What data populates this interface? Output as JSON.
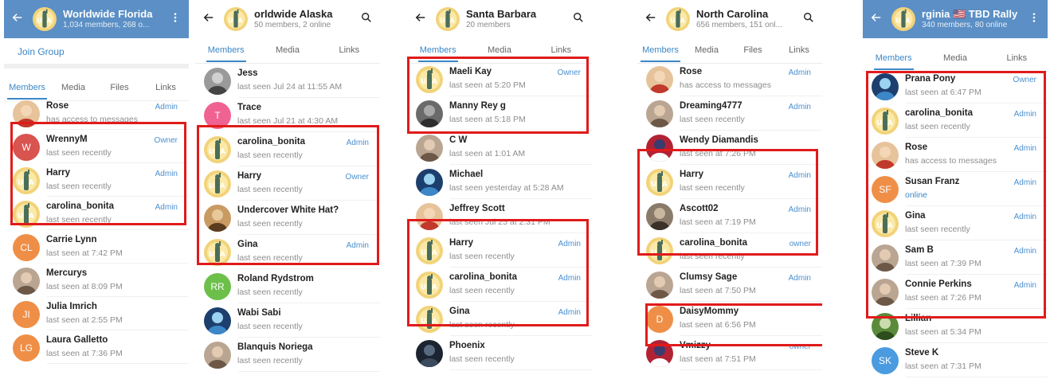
{
  "colors": {
    "header_blue": "#5b8fc5",
    "accent": "#3b87c7",
    "highlight": "#e01b1b"
  },
  "panels": [
    {
      "header": {
        "style": "blue",
        "back_icon": "arrow-left-icon",
        "title": "Worldwide Florida",
        "subtitle": "1,034 members, 268 o...",
        "actions": [
          "more-vert-icon"
        ]
      },
      "join_label": "Join Group",
      "tabs": [
        "Members",
        "Media",
        "Files",
        "Links"
      ],
      "members": [
        {
          "name": "Rose",
          "status": "has access to messages",
          "role": "Admin",
          "avatar": "photo-red-hair"
        },
        {
          "name": "WrennyM",
          "status": "last seen recently",
          "role": "Owner",
          "avatar": "letter",
          "initials": "W",
          "color": "#d9534f"
        },
        {
          "name": "Harry",
          "status": "last seen recently",
          "role": "Admin",
          "avatar": "liberty"
        },
        {
          "name": "carolina_bonita",
          "status": "last seen recently",
          "role": "Admin",
          "avatar": "liberty"
        },
        {
          "name": "Carrie Lynn",
          "status": "last seen at 7:42 PM",
          "role": "",
          "avatar": "letter",
          "initials": "CL",
          "color": "#ef8f47"
        },
        {
          "name": "Mercurys",
          "status": "last seen at 8:09 PM",
          "role": "",
          "avatar": "photo-portrait"
        },
        {
          "name": "Julia Imrich",
          "status": "last seen at 2:55 PM",
          "role": "",
          "avatar": "letter",
          "initials": "JI",
          "color": "#ef8f47"
        },
        {
          "name": "Laura Galletto",
          "status": "last seen at 7:36 PM",
          "role": "",
          "avatar": "letter",
          "initials": "LG",
          "color": "#ef8f47"
        }
      ]
    },
    {
      "header": {
        "style": "white",
        "back_icon": "arrow-left-icon",
        "title": "orldwide Alaska",
        "subtitle": "50 members, 2 online",
        "actions": [
          "search-icon"
        ]
      },
      "tabs": [
        "Members",
        "Media",
        "Links"
      ],
      "members": [
        {
          "name": "Jess",
          "status": "last seen Jul 24 at 11:55 AM",
          "role": "",
          "avatar": "photo-bw"
        },
        {
          "name": "Trace",
          "status": "last seen Jul 21 at 4:30 AM",
          "role": "",
          "avatar": "letter",
          "initials": "T",
          "color": "#f06292"
        },
        {
          "name": "carolina_bonita",
          "status": "last seen recently",
          "role": "Admin",
          "avatar": "liberty"
        },
        {
          "name": "Harry",
          "status": "last seen recently",
          "role": "Owner",
          "avatar": "liberty"
        },
        {
          "name": "Undercover White Hat? Kyle",
          "status": "last seen recently",
          "role": "",
          "avatar": "photo-book"
        },
        {
          "name": "Gina",
          "status": "last seen recently",
          "role": "Admin",
          "avatar": "liberty"
        },
        {
          "name": "Roland Rydstrom",
          "status": "last seen recently",
          "role": "",
          "avatar": "letter",
          "initials": "RR",
          "color": "#6cc04a"
        },
        {
          "name": "Wabi Sabi",
          "status": "last seen recently",
          "role": "",
          "avatar": "photo-earth"
        },
        {
          "name": "Blanquis Noriega",
          "status": "last seen recently",
          "role": "",
          "avatar": "photo-portrait"
        }
      ]
    },
    {
      "header": {
        "style": "white",
        "back_icon": "arrow-left-icon",
        "title": "Santa Barbara",
        "subtitle": "20 members",
        "actions": [
          "search-icon"
        ]
      },
      "tabs": [
        "Members",
        "Media",
        "Links"
      ],
      "members": [
        {
          "name": "Maeli Kay",
          "status": "last seen at 5:20 PM",
          "role": "Owner",
          "avatar": "liberty"
        },
        {
          "name": "Manny Rey g",
          "status": "last seen at 5:18 PM",
          "role": "",
          "avatar": "photo-dog"
        },
        {
          "name": "C W",
          "status": "last seen at 1:01 AM",
          "role": "",
          "avatar": "photo-portrait"
        },
        {
          "name": "Michael",
          "status": "last seen yesterday at 5:28 AM",
          "role": "",
          "avatar": "photo-earth"
        },
        {
          "name": "Jeffrey Scott",
          "status": "last seen Jul 25 at 2:31 PM",
          "role": "",
          "avatar": "photo-red-hair"
        },
        {
          "name": "Harry",
          "status": "last seen recently",
          "role": "Admin",
          "avatar": "liberty"
        },
        {
          "name": "carolina_bonita",
          "status": "last seen recently",
          "role": "Admin",
          "avatar": "liberty"
        },
        {
          "name": "Gina",
          "status": "last seen recently",
          "role": "Admin",
          "avatar": "liberty"
        },
        {
          "name": "Phoenix",
          "status": "last seen recently",
          "role": "",
          "avatar": "photo-dark"
        }
      ]
    },
    {
      "header": {
        "style": "white",
        "back_icon": "arrow-left-icon",
        "title": "North Carolina",
        "subtitle": "656 members, 151 onl...",
        "actions": [
          "search-icon"
        ]
      },
      "tabs": [
        "Members",
        "Media",
        "Files",
        "Links"
      ],
      "members": [
        {
          "name": "Rose",
          "status": "has access to messages",
          "role": "Admin",
          "avatar": "photo-red-hair"
        },
        {
          "name": "Dreaming4777",
          "status": "last seen recently",
          "role": "Admin",
          "avatar": "photo-portrait"
        },
        {
          "name": "Wendy Diamandis",
          "status": "last seen at 7:26 PM",
          "role": "",
          "avatar": "photo-flag"
        },
        {
          "name": "Harry",
          "status": "last seen recently",
          "role": "Admin",
          "avatar": "liberty"
        },
        {
          "name": "Ascott02",
          "status": "last seen at 7:19 PM",
          "role": "Admin",
          "avatar": "photo-cat"
        },
        {
          "name": "carolina_bonita",
          "status": "last seen recently",
          "role": "owner",
          "avatar": "liberty"
        },
        {
          "name": "Clumsy Sage",
          "status": "last seen at 7:50 PM",
          "role": "Admin",
          "avatar": "photo-portrait"
        },
        {
          "name": "DaisyMommy",
          "status": "last seen at 6:56 PM",
          "role": "",
          "avatar": "letter",
          "initials": "D",
          "color": "#ef8f47"
        },
        {
          "name": "Vmizzy",
          "status": "last seen at 7:51 PM",
          "role": "owner",
          "avatar": "photo-flag"
        }
      ]
    },
    {
      "header": {
        "style": "blue",
        "back_icon": "arrow-left-icon",
        "title": "rginia 🇺🇸 TBD Rally",
        "subtitle": "340 members, 80 online",
        "actions": [
          "more-vert-icon"
        ]
      },
      "tabs": [
        "Members",
        "Media",
        "Links"
      ],
      "members": [
        {
          "name": "Prana Pony",
          "status": "last seen at 6:47 PM",
          "role": "Owner",
          "avatar": "photo-earth"
        },
        {
          "name": "carolina_bonita",
          "status": "last seen recently",
          "role": "Admin",
          "avatar": "liberty"
        },
        {
          "name": "Rose",
          "status": "has access to messages",
          "role": "Admin",
          "avatar": "photo-red-hair"
        },
        {
          "name": "Susan Franz",
          "status": "online",
          "role": "Admin",
          "avatar": "letter",
          "initials": "SF",
          "color": "#ef8f47"
        },
        {
          "name": "Gina",
          "status": "last seen recently",
          "role": "Admin",
          "avatar": "liberty"
        },
        {
          "name": "Sam B",
          "status": "last seen at 7:39 PM",
          "role": "Admin",
          "avatar": "photo-portrait"
        },
        {
          "name": "Connie Perkins",
          "status": "last seen at 7:26 PM",
          "role": "Admin",
          "avatar": "photo-portrait"
        },
        {
          "name": "Lillian",
          "status": "last seen at 5:34 PM",
          "role": "",
          "avatar": "photo-tree"
        },
        {
          "name": "Steve K",
          "status": "last seen at 7:31 PM",
          "role": "",
          "avatar": "letter",
          "initials": "SK",
          "color": "#4a9be0"
        }
      ]
    }
  ]
}
